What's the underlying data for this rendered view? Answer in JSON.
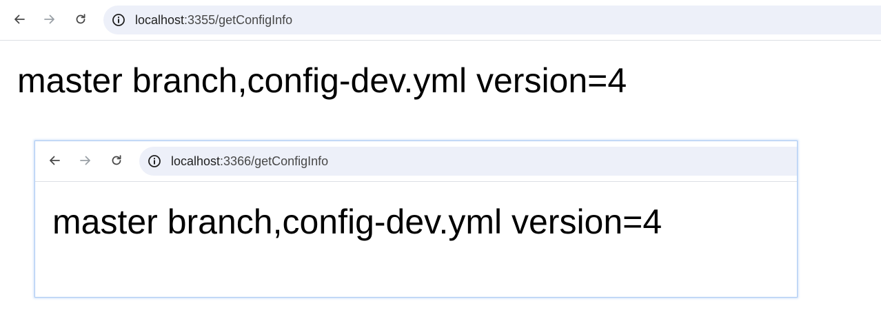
{
  "outer_browser": {
    "nav": {
      "back_icon": "arrow-left-icon",
      "forward_icon": "arrow-right-icon",
      "reload_icon": "reload-icon"
    },
    "address_bar": {
      "site_info_icon": "info-circle-icon",
      "url_host": "localhost",
      "url_rest": ":3355/getConfigInfo"
    },
    "page": {
      "body_text": "master branch,config-dev.yml version=4"
    }
  },
  "inner_browser": {
    "nav": {
      "back_icon": "arrow-left-icon",
      "forward_icon": "arrow-right-icon",
      "reload_icon": "reload-icon"
    },
    "address_bar": {
      "site_info_icon": "info-circle-icon",
      "url_host": "localhost",
      "url_rest": ":3366/getConfigInfo"
    },
    "page": {
      "body_text": "master branch,config-dev.yml version=4"
    }
  },
  "colors": {
    "omnibox_bg": "#edf0f9",
    "nav_icon_active": "#474747",
    "nav_icon_disabled": "#9aa0a6",
    "window_border_highlight": "#aecbf3"
  }
}
